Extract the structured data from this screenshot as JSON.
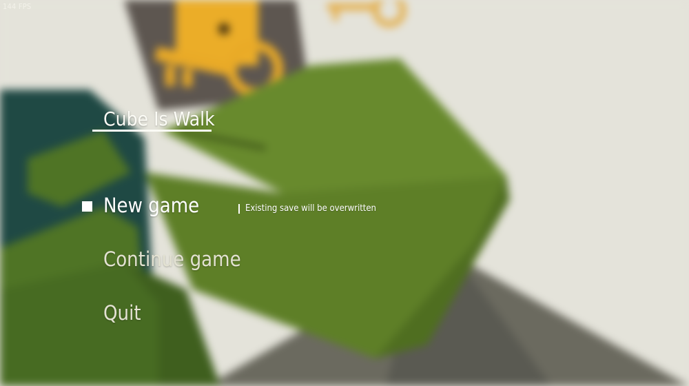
{
  "hud": {
    "fps": "144 FPS"
  },
  "game": {
    "title": "Cube Is Walk"
  },
  "menu": {
    "items": [
      {
        "label": "New game",
        "selected": true
      },
      {
        "label": "Continue game",
        "selected": false
      },
      {
        "label": "Quit",
        "selected": false
      }
    ],
    "hint": "Existing save will be overwritten",
    "selector_icon": "square-selector-icon"
  },
  "colors": {
    "background": "#e4e3da",
    "cube_green": "#6a8a30",
    "key_gold": "#e9aa27",
    "door_gray": "#5d5650",
    "text": "#ffffff"
  }
}
